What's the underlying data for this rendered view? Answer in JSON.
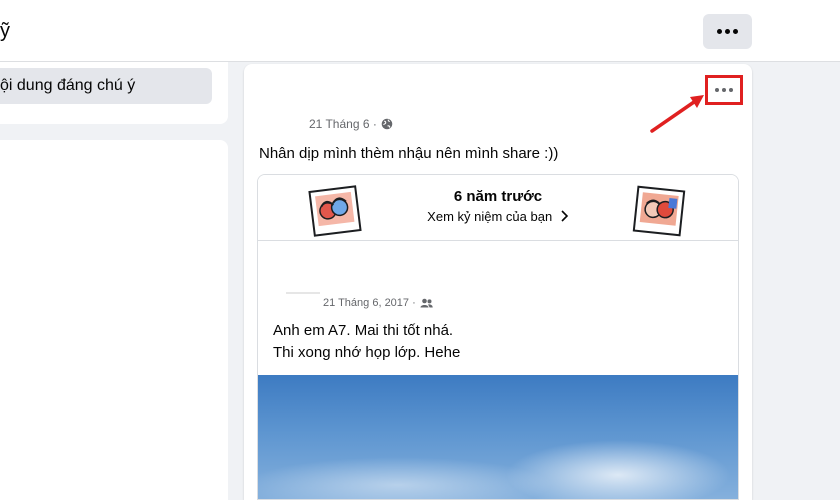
{
  "header": {
    "title_fragment": "ỹ"
  },
  "sidebar": {
    "active_item_label": "ội dung đáng chú ý"
  },
  "post": {
    "date": "21 Tháng 6 ·",
    "privacy_icon": "globe-icon",
    "text": "Nhân dịp mình thèm nhậu nên mình share :))",
    "more_icon": "more-options-icon",
    "highlight_color": "#e02020"
  },
  "memory": {
    "years_ago": "6 năm trước",
    "view_link": "Xem kỷ niệm của bạn",
    "link_icon": "chevron-right-icon",
    "original_post": {
      "date": "21 Tháng 6, 2017 ·",
      "audience_icon": "friends-icon",
      "lines": [
        "Anh em A7. Mai thi tốt nhá.",
        "Thi xong nhớ họp lớp. Hehe"
      ]
    }
  },
  "colors": {
    "background": "#f0f2f5",
    "card": "#ffffff",
    "button_gray": "#e4e6eb",
    "secondary_text": "#65676b",
    "annotation_red": "#e02020"
  }
}
